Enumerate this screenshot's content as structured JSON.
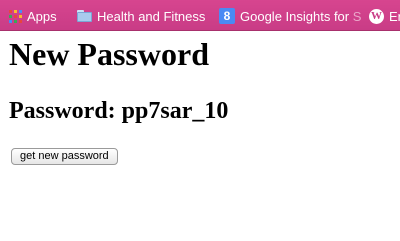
{
  "bookmarks": {
    "apps_label": "Apps",
    "health_label": "Health and Fitness",
    "google_label": "Google Insights for",
    "google_faded": "S",
    "google_icon_glyph": "8",
    "wp_label": "Er",
    "wp_icon_glyph": "W",
    "bar_color": "#c93c86",
    "apps_icon_colors": [
      "#e8453c",
      "#f9bb2d",
      "#4a8af4",
      "#3aa757",
      "#e8453c",
      "#f9bb2d",
      "#4a8af4",
      "#3aa757",
      "#e8453c"
    ]
  },
  "page": {
    "title": "New Password",
    "password_text": "Password: pp7sar_10",
    "button_label": "get new password"
  }
}
